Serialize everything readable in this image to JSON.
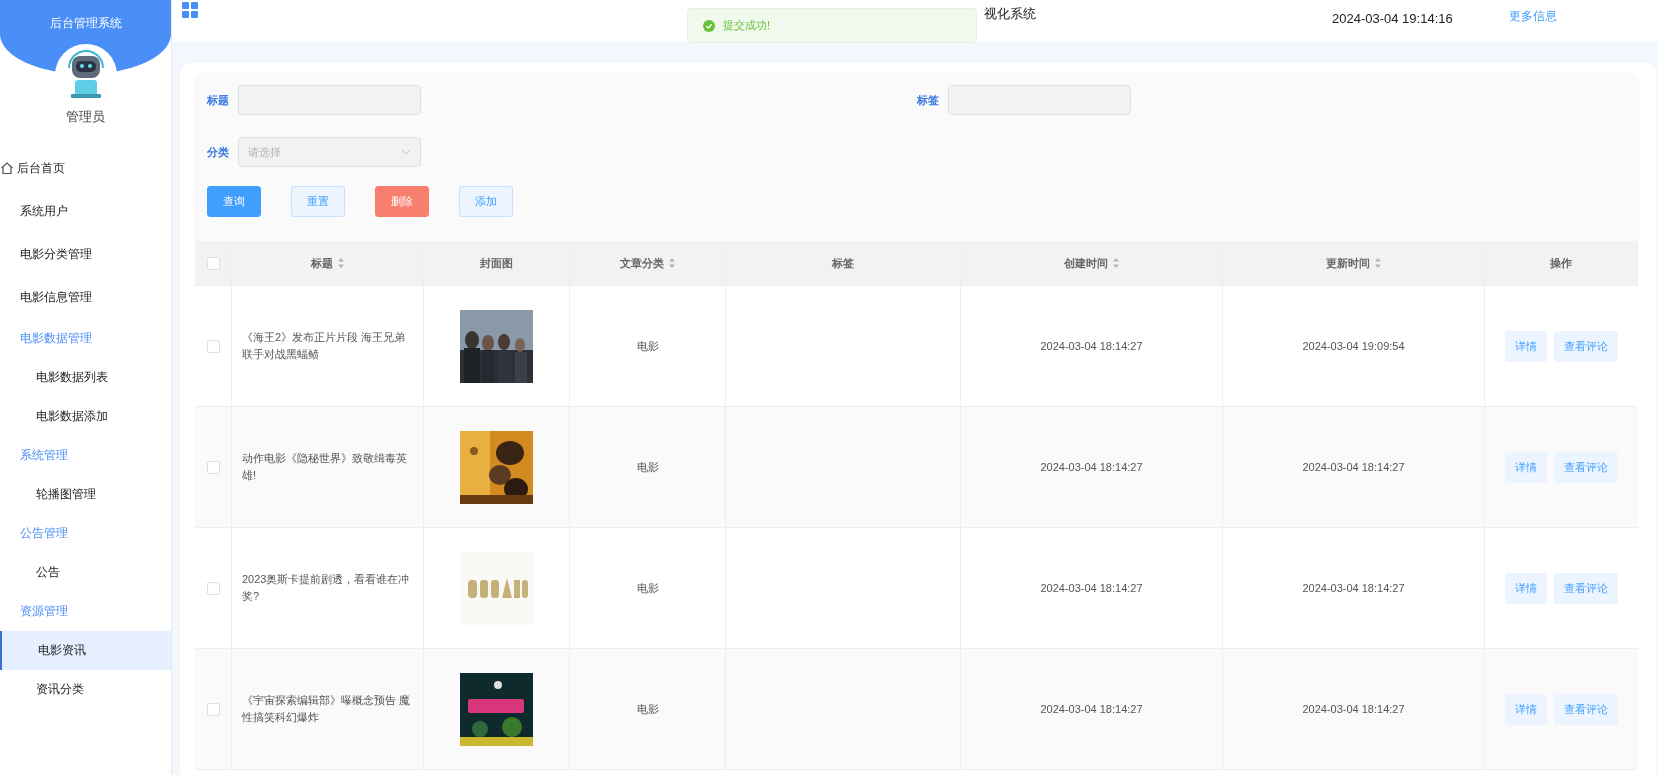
{
  "sidebar": {
    "title": "后台管理系统",
    "user": "管理员",
    "menu": [
      {
        "label": "后台首页",
        "kind": "home",
        "selected": false
      },
      {
        "label": "系统用户",
        "kind": "link",
        "selected": false
      },
      {
        "label": "电影分类管理",
        "kind": "link",
        "selected": false
      },
      {
        "label": "电影信息管理",
        "kind": "link",
        "selected": false
      },
      {
        "label": "电影数据管理",
        "kind": "group",
        "selected": false,
        "children": [
          {
            "label": "电影数据列表",
            "selected": false
          },
          {
            "label": "电影数据添加",
            "selected": false
          }
        ]
      },
      {
        "label": "系统管理",
        "kind": "group",
        "selected": false,
        "children": [
          {
            "label": "轮播图管理",
            "selected": false
          }
        ]
      },
      {
        "label": "公告管理",
        "kind": "group",
        "selected": false,
        "children": [
          {
            "label": "公告",
            "selected": false
          }
        ]
      },
      {
        "label": "资源管理",
        "kind": "group",
        "selected": false,
        "children": [
          {
            "label": "电影资讯",
            "selected": true
          },
          {
            "label": "资讯分类",
            "selected": false
          }
        ]
      }
    ]
  },
  "header": {
    "title": "视化系统",
    "datetime": "2024-03-04 19:14:16",
    "more_link": "更多信息"
  },
  "toast": {
    "message": "提交成功!"
  },
  "filters": {
    "title_label": "标题",
    "tag_label": "标签",
    "category_label": "分类",
    "category_placeholder": "请选择"
  },
  "buttons": [
    {
      "label": "查询",
      "kind": "primary"
    },
    {
      "label": "重置",
      "kind": "plain"
    },
    {
      "label": "删除",
      "kind": "danger"
    },
    {
      "label": "添加",
      "kind": "plain"
    }
  ],
  "table": {
    "header_checked": false,
    "columns": [
      {
        "label": "标题",
        "sortable": true
      },
      {
        "label": "封面图",
        "sortable": false
      },
      {
        "label": "文章分类",
        "sortable": true
      },
      {
        "label": "标签",
        "sortable": false
      },
      {
        "label": "创建时间",
        "sortable": true
      },
      {
        "label": "更新时间",
        "sortable": true
      },
      {
        "label": "操作",
        "sortable": false
      }
    ],
    "rows": [
      {
        "checked": false,
        "title": "《海王2》发布正片片段 海王兄弟联手对战黑蝠鲼",
        "category": "电影",
        "created": "2024-03-04 18:14:27",
        "updated": "2024-03-04 19:09:54",
        "actions": [
          "详情",
          "查看评论"
        ]
      },
      {
        "checked": false,
        "title": "动作电影《隐秘世界》致敬缉毒英雄!",
        "category": "电影",
        "created": "2024-03-04 18:14:27",
        "updated": "2024-03-04 18:14:27",
        "actions": [
          "详情",
          "查看评论"
        ]
      },
      {
        "checked": false,
        "title": "2023奥斯卡提前剧透，看看谁在冲奖?",
        "category": "电影",
        "created": "2024-03-04 18:14:27",
        "updated": "2024-03-04 18:14:27",
        "actions": [
          "详情",
          "查看评论"
        ]
      },
      {
        "checked": false,
        "title": "《宇宙探索编辑部》曝概念预告 魔性搞笑科幻爆炸",
        "category": "电影",
        "created": "2024-03-04 18:14:27",
        "updated": "2024-03-04 18:14:27",
        "actions": [
          "详情",
          "查看评论"
        ]
      }
    ]
  }
}
